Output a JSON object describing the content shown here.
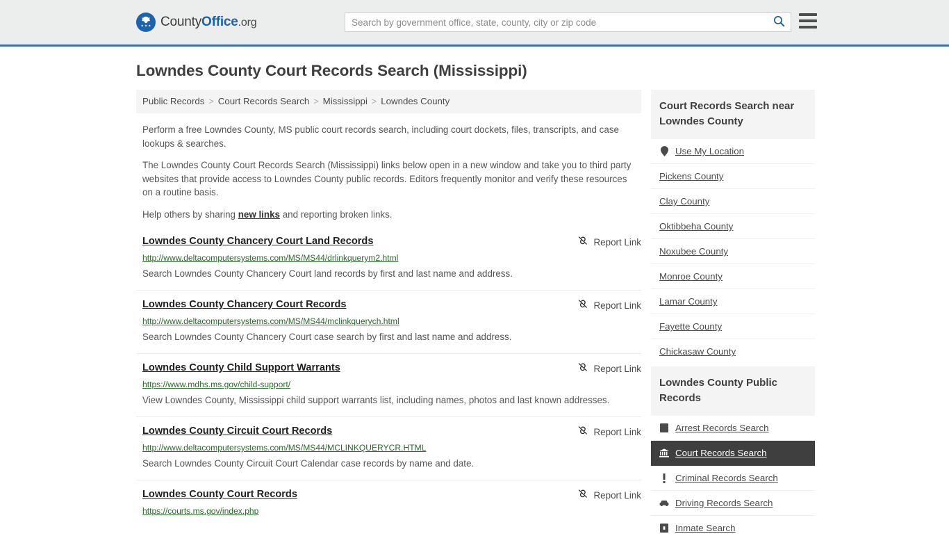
{
  "header": {
    "brand": {
      "part1": "County",
      "part2": "Office",
      "part3": ".org",
      "logo_icon": "eagle-shield-logo"
    },
    "search": {
      "placeholder": "Search by government office, state, county, city or zip code",
      "value": "",
      "button_icon": "search-icon"
    },
    "menu_icon": "hamburger-menu-icon",
    "accent_color": "#3a72a4"
  },
  "page_title": "Lowndes County Court Records Search (Mississippi)",
  "breadcrumb": {
    "separator": ">",
    "items": [
      {
        "label": "Public Records"
      },
      {
        "label": "Court Records Search"
      },
      {
        "label": "Mississippi"
      },
      {
        "label": "Lowndes County"
      }
    ]
  },
  "intro": {
    "p1": "Perform a free Lowndes County, MS public court records search, including court dockets, files, transcripts, and case lookups & searches.",
    "p2": "The Lowndes County Court Records Search (Mississippi) links below open in a new window and take you to third party websites that provide access to Lowndes County public records. Editors frequently monitor and verify these resources on a routine basis.",
    "p3_before": "Help others by sharing ",
    "p3_link": "new links",
    "p3_after": " and reporting broken links."
  },
  "report_link": {
    "label": "Report Link",
    "icon": "broken-link-icon"
  },
  "links": [
    {
      "title": "Lowndes County Chancery Court Land Records",
      "url": "http://www.deltacomputersystems.com/MS/MS44/drlinkquerym2.html",
      "description": "Search Lowndes County Chancery Court land records by first and last name and address."
    },
    {
      "title": "Lowndes County Chancery Court Records",
      "url": "http://www.deltacomputersystems.com/MS/MS44/mclinkquerych.html",
      "description": "Search Lowndes County Chancery Court case search by first and last name and address."
    },
    {
      "title": "Lowndes County Child Support Warrants",
      "url": "https://www.mdhs.ms.gov/child-support/",
      "description": "View Lowndes County, Mississippi child support warrants list, including names, photos and last known addresses."
    },
    {
      "title": "Lowndes County Circuit Court Records",
      "url": "http://www.deltacomputersystems.com/MS/MS44/MCLINKQUERYCR.HTML",
      "description": "Search Lowndes County Circuit Court Calendar case records by name and date."
    },
    {
      "title": "Lowndes County Court Records",
      "url": "https://courts.ms.gov/index.php",
      "description": ""
    }
  ],
  "sidebar": {
    "nearby": {
      "heading": "Court Records Search near Lowndes County",
      "items": [
        {
          "label": "Use My Location",
          "icon": "map-pin-icon",
          "has_icon": true
        },
        {
          "label": "Pickens County",
          "icon": "",
          "has_icon": false
        },
        {
          "label": "Clay County",
          "icon": "",
          "has_icon": false
        },
        {
          "label": "Oktibbeha County",
          "icon": "",
          "has_icon": false
        },
        {
          "label": "Noxubee County",
          "icon": "",
          "has_icon": false
        },
        {
          "label": "Monroe County",
          "icon": "",
          "has_icon": false
        },
        {
          "label": "Lamar County",
          "icon": "",
          "has_icon": false
        },
        {
          "label": "Fayette County",
          "icon": "",
          "has_icon": false
        },
        {
          "label": "Chickasaw County",
          "icon": "",
          "has_icon": false
        }
      ]
    },
    "public_records": {
      "heading": "Lowndes County Public Records",
      "items": [
        {
          "label": "Arrest Records Search",
          "icon": "book-icon",
          "active": false
        },
        {
          "label": "Court Records Search",
          "icon": "courthouse-icon",
          "active": true
        },
        {
          "label": "Criminal Records Search",
          "icon": "exclamation-icon",
          "active": false
        },
        {
          "label": "Driving Records Search",
          "icon": "car-icon",
          "active": false
        },
        {
          "label": "Inmate Search",
          "icon": "jail-cell-icon",
          "active": false
        }
      ]
    },
    "active_bg_color": "#3f3f3f"
  }
}
